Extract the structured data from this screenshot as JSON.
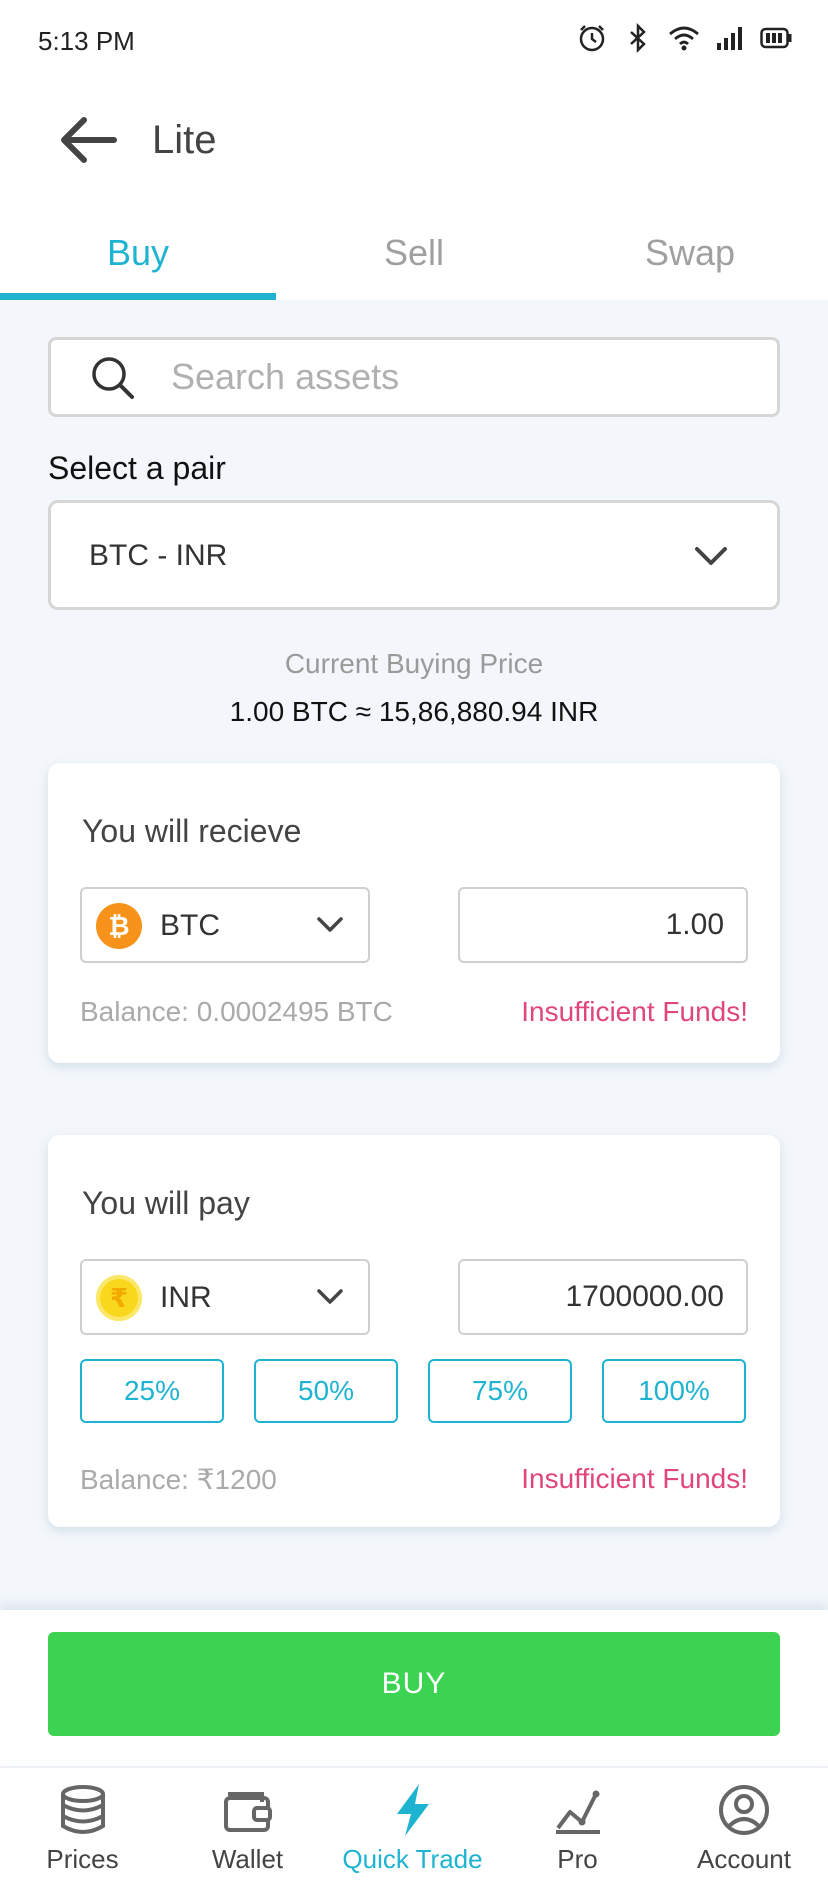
{
  "status_bar": {
    "time": "5:13 PM"
  },
  "header": {
    "title": "Lite"
  },
  "tabs": [
    {
      "label": "Buy",
      "active": true
    },
    {
      "label": "Sell",
      "active": false
    },
    {
      "label": "Swap",
      "active": false
    }
  ],
  "search": {
    "placeholder": "Search assets",
    "value": ""
  },
  "pair": {
    "label": "Select a pair",
    "selected": "BTC - INR"
  },
  "price": {
    "label": "Current Buying Price",
    "value": "1.00 BTC ≈ 15,86,880.94 INR"
  },
  "receive": {
    "title": "You will recieve",
    "asset": "BTC",
    "amount": "1.00",
    "balance": "Balance: 0.0002495 BTC",
    "warning": "Insufficient Funds!"
  },
  "pay": {
    "title": "You will pay",
    "asset": "INR",
    "amount": "1700000.00",
    "percentages": [
      "25%",
      "50%",
      "75%",
      "100%"
    ],
    "balance": "Balance: ₹1200",
    "warning": "Insufficient Funds!"
  },
  "buy_button": {
    "label": "BUY"
  },
  "bottom_nav": [
    {
      "label": "Prices",
      "icon": "database-icon",
      "active": false
    },
    {
      "label": "Wallet",
      "icon": "wallet-icon",
      "active": false
    },
    {
      "label": "Quick Trade",
      "icon": "lightning-icon",
      "active": true
    },
    {
      "label": "Pro",
      "icon": "chart-line-icon",
      "active": false
    },
    {
      "label": "Account",
      "icon": "user-circle-icon",
      "active": false
    }
  ],
  "colors": {
    "accent": "#1fb3d2",
    "buy": "#3dd352",
    "warning": "#e0457b",
    "background": "#f3f7fb"
  }
}
